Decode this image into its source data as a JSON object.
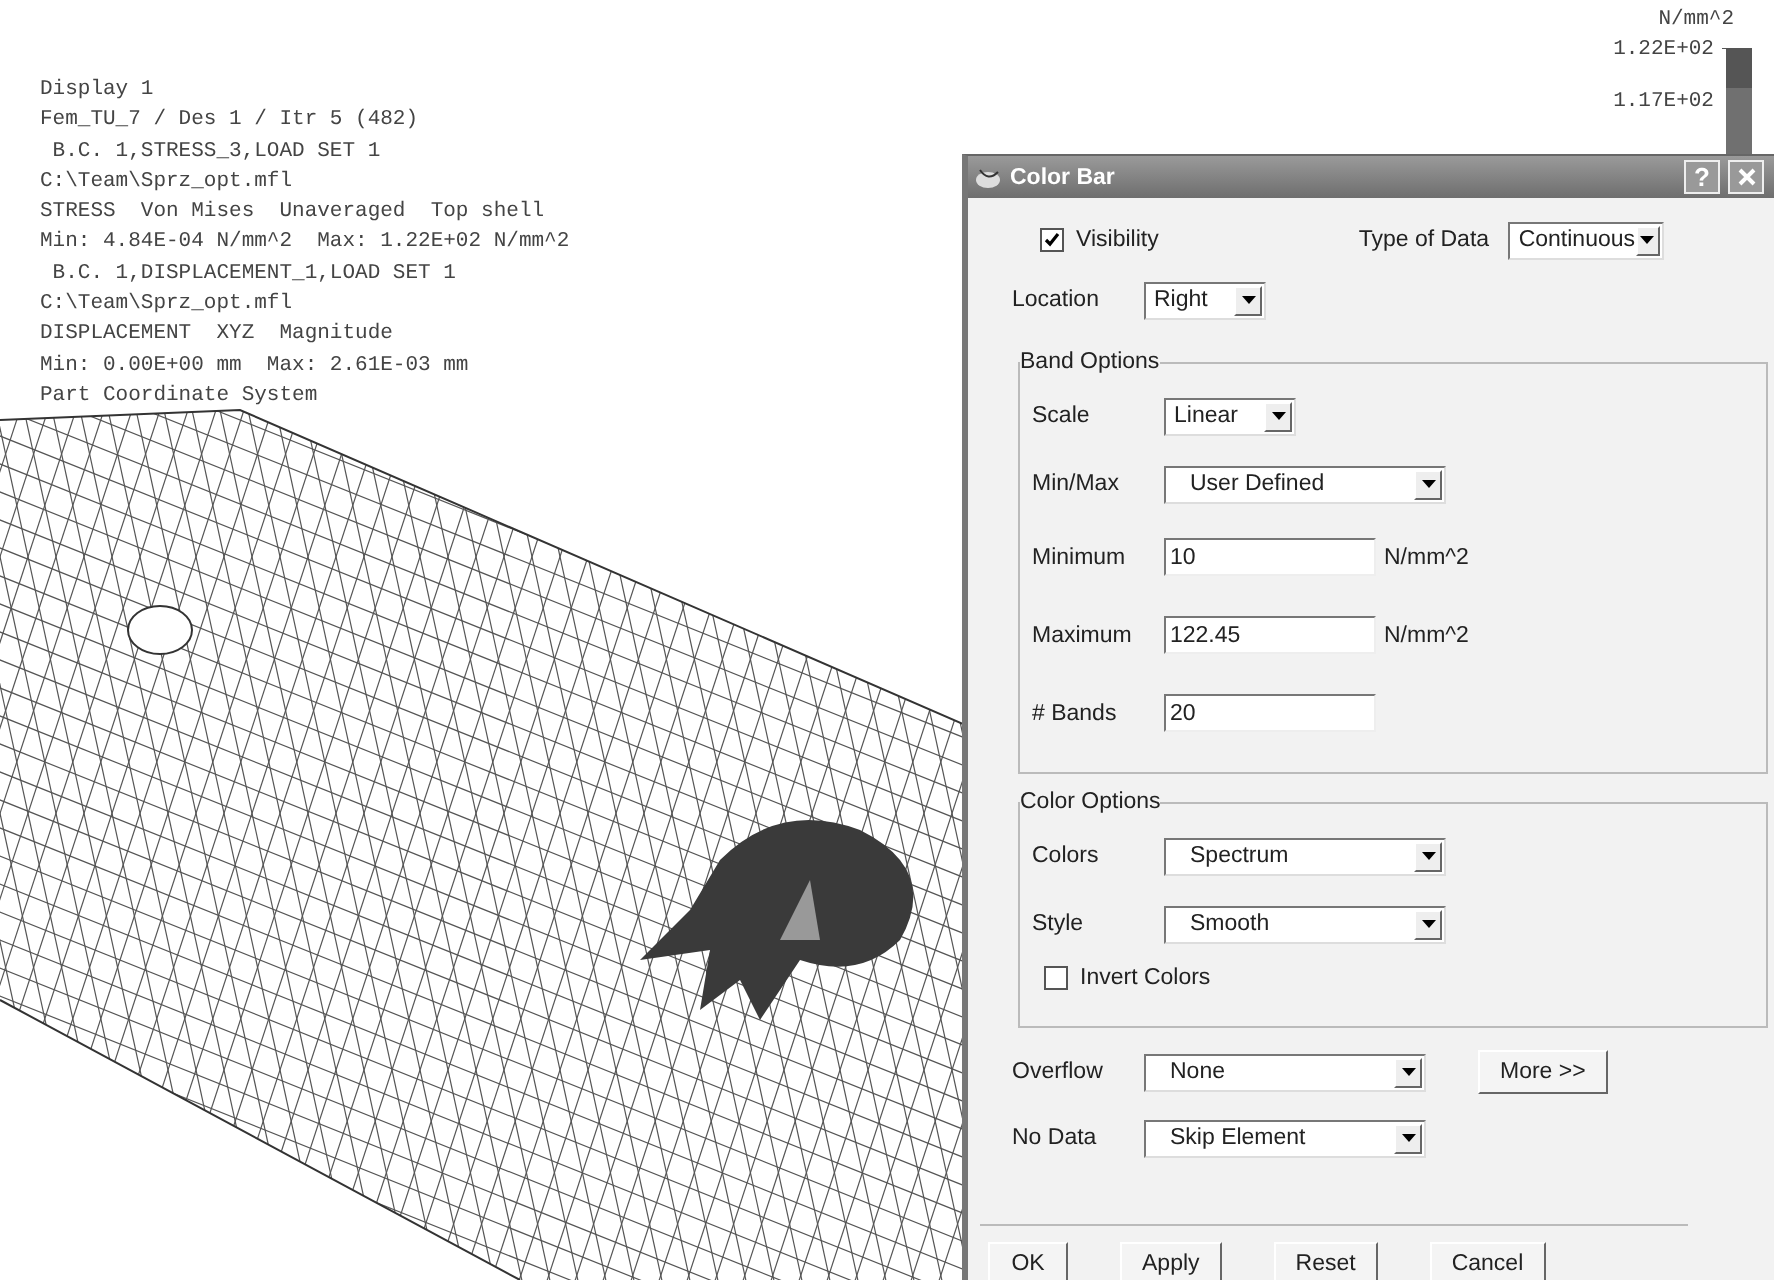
{
  "canvas": {
    "info_lines": [
      "Display 1",
      "Fem_TU_7 / Des 1 / Itr 5 (482)",
      " B.C. 1,STRESS_3,LOAD SET 1",
      "C:\\Team\\Sprz_opt.mfl",
      "STRESS  Von Mises  Unaveraged  Top shell",
      "Min: 4.84E-04 N/mm^2  Max: 1.22E+02 N/mm^2",
      " B.C. 1,DISPLACEMENT_1,LOAD SET 1",
      "C:\\Team\\Sprz_opt.mfl",
      "DISPLACEMENT  XYZ  Magnitude",
      "Min: 0.00E+00 mm  Max: 2.61E-03 mm",
      "Part Coordinate System"
    ],
    "legend": {
      "unit": "N/mm^2",
      "labels": [
        "1.22E+02",
        "1.17E+02"
      ]
    }
  },
  "dialog": {
    "title": "Color Bar",
    "help": "?",
    "visibility": {
      "label": "Visibility",
      "checked": true
    },
    "type_of_data": {
      "label": "Type of Data",
      "value": "Continuous"
    },
    "location": {
      "label": "Location",
      "value": "Right"
    },
    "band_options": {
      "title": "Band Options",
      "rows": [
        {
          "kind": "short-select",
          "label": "Scale",
          "value": "Linear"
        },
        {
          "kind": "select",
          "label": "Min/Max",
          "value": "User Defined"
        },
        {
          "kind": "input",
          "label": "Minimum",
          "value": "10",
          "unit": "N/mm^2"
        },
        {
          "kind": "input",
          "label": "Maximum",
          "value": "122.45",
          "unit": "N/mm^2"
        },
        {
          "kind": "input",
          "label": "# Bands",
          "value": "20"
        }
      ]
    },
    "color_options": {
      "title": "Color Options",
      "rows": [
        {
          "kind": "select",
          "label": "Colors",
          "value": "Spectrum"
        },
        {
          "kind": "select",
          "label": "Style",
          "value": "Smooth"
        }
      ],
      "invert": {
        "label": "Invert Colors",
        "checked": false
      }
    },
    "overflow": {
      "label": "Overflow",
      "value": "None"
    },
    "more_button": "More >>",
    "no_data": {
      "label": "No Data",
      "value": "Skip Element"
    },
    "buttons": [
      "OK",
      "Apply",
      "Reset",
      "Cancel"
    ]
  }
}
